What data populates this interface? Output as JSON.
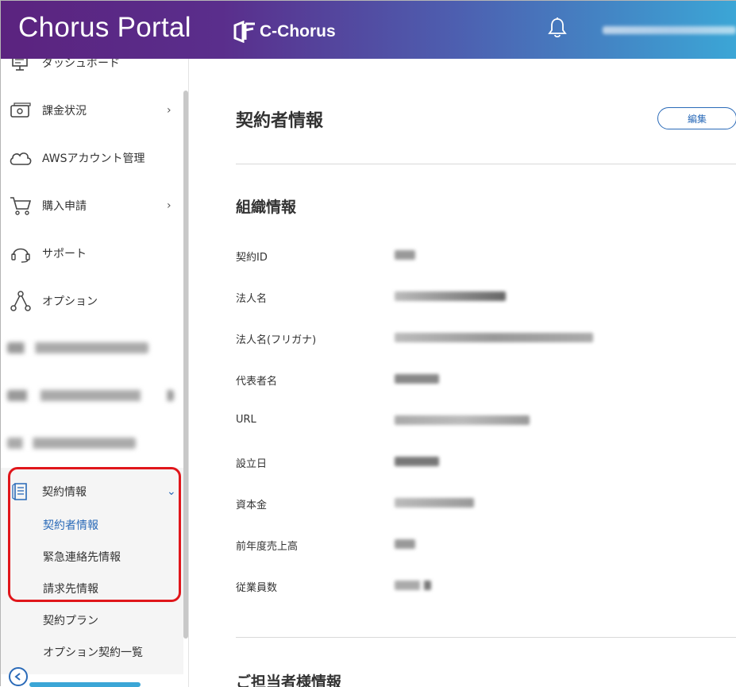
{
  "header": {
    "app_title": "Chorus Portal",
    "brand_name": "C-Chorus",
    "notification_icon": "bell-icon"
  },
  "sidebar": {
    "items": [
      {
        "label": "ダッシュボード",
        "icon": "dashboard-icon"
      },
      {
        "label": "課金状況",
        "icon": "billing-icon",
        "has_submenu": true
      },
      {
        "label": "AWSアカウント管理",
        "icon": "cloud-icon"
      },
      {
        "label": "購入申請",
        "icon": "cart-icon",
        "has_submenu": true
      },
      {
        "label": "サポート",
        "icon": "headset-icon"
      },
      {
        "label": "オプション",
        "icon": "option-icon"
      }
    ],
    "contract_group": {
      "label": "契約情報",
      "icon": "document-icon",
      "expanded": true,
      "children": [
        {
          "label": "契約者情報",
          "active": true
        },
        {
          "label": "緊急連絡先情報",
          "active": false
        },
        {
          "label": "請求先情報",
          "active": false
        },
        {
          "label": "契約プラン",
          "active": false
        },
        {
          "label": "オプション契約一覧",
          "active": false
        }
      ]
    },
    "collapse_icon": "chevron-left-icon"
  },
  "main": {
    "page_title": "契約者情報",
    "edit_label": "編集",
    "org_section_title": "組織情報",
    "fields": [
      {
        "label": "契約ID"
      },
      {
        "label": "法人名"
      },
      {
        "label": "法人名(フリガナ)"
      },
      {
        "label": "代表者名"
      },
      {
        "label": "URL"
      },
      {
        "label": "設立日"
      },
      {
        "label": "資本金"
      },
      {
        "label": "前年度売上高"
      },
      {
        "label": "従業員数"
      }
    ],
    "contact_section_title": "ご担当者様情報"
  },
  "colors": {
    "header_gradient_start": "#5b237f",
    "header_gradient_end": "#3ba6d6",
    "accent": "#2a6ab8",
    "highlight": "#e0161b"
  }
}
